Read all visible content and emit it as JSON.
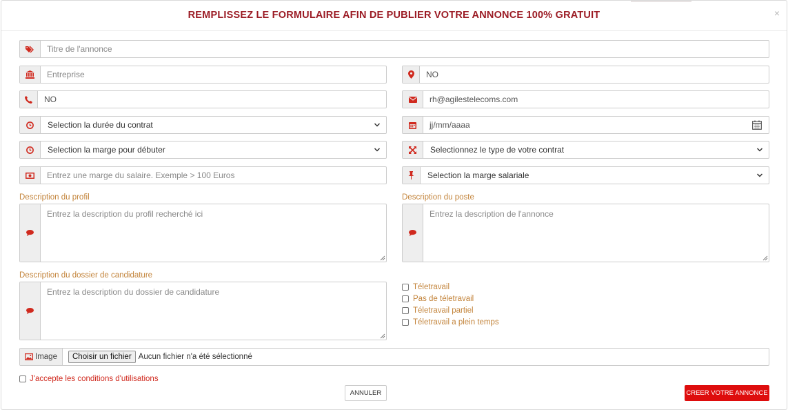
{
  "modal": {
    "title": "REMPLISSEZ LE FORMULAIRE AFIN DE PUBLIER VOTRE ANNONCE 100% GRATUIT",
    "close_label": "×"
  },
  "fields": {
    "titre": {
      "placeholder": "Titre de l'annonce",
      "icon": "tag-icon"
    },
    "entreprise": {
      "placeholder": "Entreprise",
      "icon": "bank-icon"
    },
    "localisation": {
      "value": "NO",
      "icon": "map-marker-icon"
    },
    "telephone": {
      "value": "NO",
      "icon": "phone-icon"
    },
    "email": {
      "value": "rh@agilestelecoms.com",
      "icon": "envelope-icon"
    },
    "duree_contrat": {
      "selected": "Selection la durée du contrat",
      "icon": "clock-icon"
    },
    "date": {
      "placeholder": "jj/mm/aaaa",
      "icon": "calendar-icon"
    },
    "marge_debut": {
      "selected": "Selection la marge pour débuter",
      "icon": "clock-icon"
    },
    "type_contrat": {
      "selected": "Selectionnez le type de votre contrat",
      "icon": "expand-icon"
    },
    "salaire": {
      "placeholder": "Entrez une marge du salaire. Exemple > 100 Euros",
      "icon": "money-icon"
    },
    "marge_salariale": {
      "selected": "Selection la marge salariale",
      "icon": "pushpin-icon"
    }
  },
  "textareas": {
    "profil": {
      "label": "Description du profil",
      "placeholder": "Entrez la description du profil recherché ici"
    },
    "poste": {
      "label": "Description du poste",
      "placeholder": "Entrez la description de l'annonce"
    },
    "dossier": {
      "label": "Description du dossier de candidature",
      "placeholder": "Entrez la description du dossier de candidature"
    }
  },
  "checkboxes": [
    {
      "label": "Téletravail",
      "checked": false
    },
    {
      "label": "Pas de téletravail",
      "checked": false
    },
    {
      "label": "Téletravail partiel",
      "checked": false
    },
    {
      "label": "Téletravail a plein temps",
      "checked": false
    }
  ],
  "image": {
    "label": "Image",
    "button_label": "Choisir un fichier",
    "status": "Aucun fichier n'a été sélectionné"
  },
  "terms": {
    "label": "J'accepte les conditions d'utilisations",
    "checked": false
  },
  "buttons": {
    "cancel": "ANNULER",
    "create": "CREER VOTRE ANNONCE"
  },
  "colors": {
    "title": "#9b1b24",
    "icon": "#d0291e",
    "label": "#c3843b",
    "primary_button": "#de0d0d"
  }
}
